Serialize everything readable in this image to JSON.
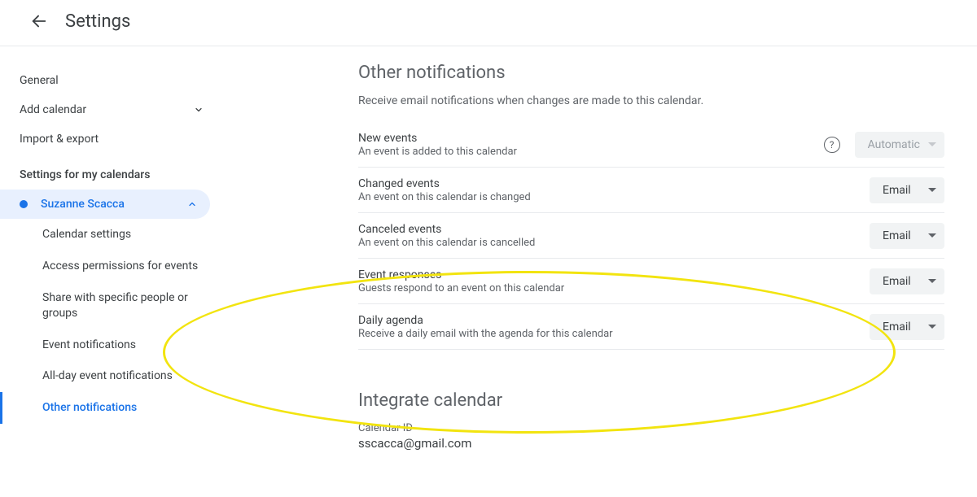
{
  "header": {
    "title": "Settings"
  },
  "sidebar": {
    "general": "General",
    "add_calendar": "Add calendar",
    "import_export": "Import & export",
    "section_title": "Settings for my calendars",
    "calendar_owner": "Suzanne Scacca",
    "subitems": {
      "calendar_settings": "Calendar settings",
      "access_permissions": "Access permissions for events",
      "share_specific": "Share with specific people or groups",
      "event_notifications": "Event notifications",
      "all_day_notifications": "All-day event notifications",
      "other_notifications": "Other notifications"
    }
  },
  "main": {
    "heading": "Other notifications",
    "description": "Receive email notifications when changes are made to this calendar.",
    "rows": {
      "new_events": {
        "title": "New events",
        "sub": "An event is added to this calendar",
        "value": "Automatic"
      },
      "changed_events": {
        "title": "Changed events",
        "sub": "An event on this calendar is changed",
        "value": "Email"
      },
      "canceled_events": {
        "title": "Canceled events",
        "sub": "An event on this calendar is cancelled",
        "value": "Email"
      },
      "event_responses": {
        "title": "Event responses",
        "sub": "Guests respond to an event on this calendar",
        "value": "Email"
      },
      "daily_agenda": {
        "title": "Daily agenda",
        "sub": "Receive a daily email with the agenda for this calendar",
        "value": "Email"
      }
    },
    "integrate": {
      "heading": "Integrate calendar",
      "id_label": "Calendar ID",
      "id_value": "sscacca@gmail.com"
    }
  }
}
